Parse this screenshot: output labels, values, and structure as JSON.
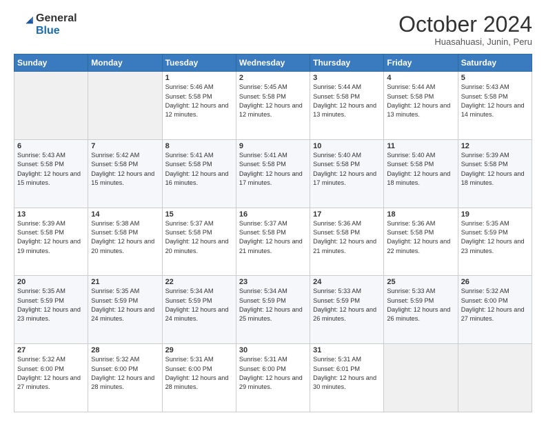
{
  "logo": {
    "general": "General",
    "blue": "Blue"
  },
  "header": {
    "month": "October 2024",
    "location": "Huasahuasi, Junin, Peru"
  },
  "weekdays": [
    "Sunday",
    "Monday",
    "Tuesday",
    "Wednesday",
    "Thursday",
    "Friday",
    "Saturday"
  ],
  "weeks": [
    [
      {
        "day": "",
        "info": ""
      },
      {
        "day": "",
        "info": ""
      },
      {
        "day": "1",
        "info": "Sunrise: 5:46 AM\nSunset: 5:58 PM\nDaylight: 12 hours\nand 12 minutes."
      },
      {
        "day": "2",
        "info": "Sunrise: 5:45 AM\nSunset: 5:58 PM\nDaylight: 12 hours\nand 12 minutes."
      },
      {
        "day": "3",
        "info": "Sunrise: 5:44 AM\nSunset: 5:58 PM\nDaylight: 12 hours\nand 13 minutes."
      },
      {
        "day": "4",
        "info": "Sunrise: 5:44 AM\nSunset: 5:58 PM\nDaylight: 12 hours\nand 13 minutes."
      },
      {
        "day": "5",
        "info": "Sunrise: 5:43 AM\nSunset: 5:58 PM\nDaylight: 12 hours\nand 14 minutes."
      }
    ],
    [
      {
        "day": "6",
        "info": "Sunrise: 5:43 AM\nSunset: 5:58 PM\nDaylight: 12 hours\nand 15 minutes."
      },
      {
        "day": "7",
        "info": "Sunrise: 5:42 AM\nSunset: 5:58 PM\nDaylight: 12 hours\nand 15 minutes."
      },
      {
        "day": "8",
        "info": "Sunrise: 5:41 AM\nSunset: 5:58 PM\nDaylight: 12 hours\nand 16 minutes."
      },
      {
        "day": "9",
        "info": "Sunrise: 5:41 AM\nSunset: 5:58 PM\nDaylight: 12 hours\nand 17 minutes."
      },
      {
        "day": "10",
        "info": "Sunrise: 5:40 AM\nSunset: 5:58 PM\nDaylight: 12 hours\nand 17 minutes."
      },
      {
        "day": "11",
        "info": "Sunrise: 5:40 AM\nSunset: 5:58 PM\nDaylight: 12 hours\nand 18 minutes."
      },
      {
        "day": "12",
        "info": "Sunrise: 5:39 AM\nSunset: 5:58 PM\nDaylight: 12 hours\nand 18 minutes."
      }
    ],
    [
      {
        "day": "13",
        "info": "Sunrise: 5:39 AM\nSunset: 5:58 PM\nDaylight: 12 hours\nand 19 minutes."
      },
      {
        "day": "14",
        "info": "Sunrise: 5:38 AM\nSunset: 5:58 PM\nDaylight: 12 hours\nand 20 minutes."
      },
      {
        "day": "15",
        "info": "Sunrise: 5:37 AM\nSunset: 5:58 PM\nDaylight: 12 hours\nand 20 minutes."
      },
      {
        "day": "16",
        "info": "Sunrise: 5:37 AM\nSunset: 5:58 PM\nDaylight: 12 hours\nand 21 minutes."
      },
      {
        "day": "17",
        "info": "Sunrise: 5:36 AM\nSunset: 5:58 PM\nDaylight: 12 hours\nand 21 minutes."
      },
      {
        "day": "18",
        "info": "Sunrise: 5:36 AM\nSunset: 5:58 PM\nDaylight: 12 hours\nand 22 minutes."
      },
      {
        "day": "19",
        "info": "Sunrise: 5:35 AM\nSunset: 5:59 PM\nDaylight: 12 hours\nand 23 minutes."
      }
    ],
    [
      {
        "day": "20",
        "info": "Sunrise: 5:35 AM\nSunset: 5:59 PM\nDaylight: 12 hours\nand 23 minutes."
      },
      {
        "day": "21",
        "info": "Sunrise: 5:35 AM\nSunset: 5:59 PM\nDaylight: 12 hours\nand 24 minutes."
      },
      {
        "day": "22",
        "info": "Sunrise: 5:34 AM\nSunset: 5:59 PM\nDaylight: 12 hours\nand 24 minutes."
      },
      {
        "day": "23",
        "info": "Sunrise: 5:34 AM\nSunset: 5:59 PM\nDaylight: 12 hours\nand 25 minutes."
      },
      {
        "day": "24",
        "info": "Sunrise: 5:33 AM\nSunset: 5:59 PM\nDaylight: 12 hours\nand 26 minutes."
      },
      {
        "day": "25",
        "info": "Sunrise: 5:33 AM\nSunset: 5:59 PM\nDaylight: 12 hours\nand 26 minutes."
      },
      {
        "day": "26",
        "info": "Sunrise: 5:32 AM\nSunset: 6:00 PM\nDaylight: 12 hours\nand 27 minutes."
      }
    ],
    [
      {
        "day": "27",
        "info": "Sunrise: 5:32 AM\nSunset: 6:00 PM\nDaylight: 12 hours\nand 27 minutes."
      },
      {
        "day": "28",
        "info": "Sunrise: 5:32 AM\nSunset: 6:00 PM\nDaylight: 12 hours\nand 28 minutes."
      },
      {
        "day": "29",
        "info": "Sunrise: 5:31 AM\nSunset: 6:00 PM\nDaylight: 12 hours\nand 28 minutes."
      },
      {
        "day": "30",
        "info": "Sunrise: 5:31 AM\nSunset: 6:00 PM\nDaylight: 12 hours\nand 29 minutes."
      },
      {
        "day": "31",
        "info": "Sunrise: 5:31 AM\nSunset: 6:01 PM\nDaylight: 12 hours\nand 30 minutes."
      },
      {
        "day": "",
        "info": ""
      },
      {
        "day": "",
        "info": ""
      }
    ]
  ]
}
